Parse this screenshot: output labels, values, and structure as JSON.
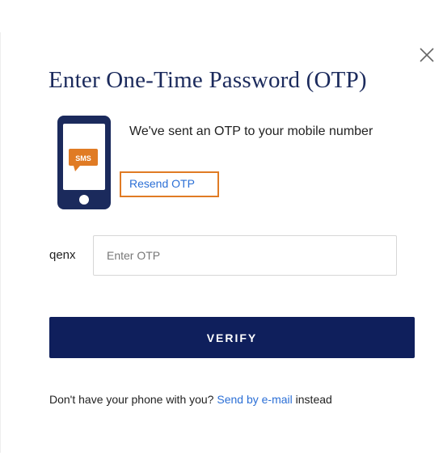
{
  "dialog": {
    "title": "Enter One-Time Password (OTP)",
    "close_icon": "close-icon",
    "illustration": {
      "icon": "phone-sms-icon",
      "sms_badge": "SMS"
    },
    "message": "We've sent an OTP to your mobile number",
    "resend_label": "Resend OTP",
    "otp_prefix": "qenx",
    "otp_input": {
      "value": "",
      "placeholder": "Enter OTP"
    },
    "verify_label": "VERIFY",
    "footer": {
      "text": "Don't have your phone with you? ",
      "link_label": "Send by e-mail",
      "suffix": " instead"
    }
  },
  "colors": {
    "primary": "#0f1f5c",
    "title": "#1b2a5c",
    "link": "#2b6fd6",
    "highlight": "#e07b24",
    "sms_badge": "#e07b24"
  }
}
